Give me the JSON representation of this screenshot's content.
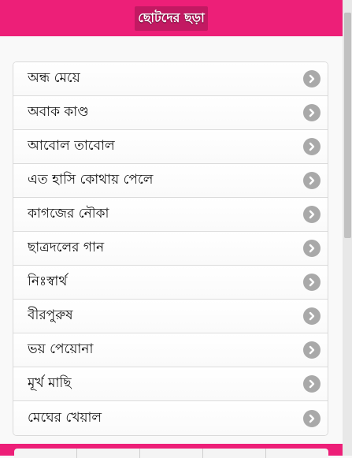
{
  "header": {
    "title": "ছোটদের ছড়া"
  },
  "list": {
    "items": [
      {
        "label": "অন্ধ মেয়ে"
      },
      {
        "label": "অবাক কাণ্ড"
      },
      {
        "label": "আবোল তাবোল"
      },
      {
        "label": "এত হাসি কোথায় পেলে"
      },
      {
        "label": "কাগজের নৌকা"
      },
      {
        "label": "ছাত্রদলের গান"
      },
      {
        "label": "নিঃস্বার্থ"
      },
      {
        "label": "বীরপুরুষ"
      },
      {
        "label": "ভয় পেয়োনা"
      },
      {
        "label": "মূর্খ মাছি"
      },
      {
        "label": "মেঘের খেয়াল"
      }
    ]
  },
  "icons": {
    "item_arrow": "chevron-right-icon"
  },
  "colors": {
    "header": "#ed1f78",
    "arrow": "#a9a9a9"
  }
}
